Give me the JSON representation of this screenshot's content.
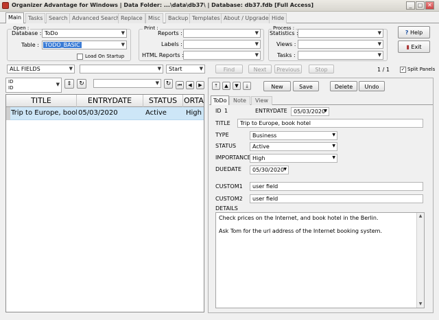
{
  "window": {
    "title": "Organizer Advantage for Windows | Data Folder: ...\\data\\db37\\ | Database: db37.fdb [Full Access]",
    "min": "_",
    "max": "□",
    "close": "✕"
  },
  "tabs": [
    "Main",
    "Tasks",
    "Search",
    "Advanced Search",
    "Replace",
    "Misc",
    "Backup",
    "Templates",
    "About / Upgrade",
    "Hide"
  ],
  "open_group": {
    "title": "Open :",
    "database_label": "Database :",
    "database_value": "ToDo",
    "table_label": "Table :",
    "table_value": "TODO_BASIC",
    "load_on_startup": "Load On Startup"
  },
  "print_group": {
    "title": "Print :",
    "reports": "Reports :",
    "labels": "Labels :",
    "html_reports": "HTML Reports :"
  },
  "process_group": {
    "title": "Process :",
    "statistics": "Statistics :",
    "views": "Views :",
    "tasks": "Tasks :"
  },
  "side_buttons": {
    "help": "Help",
    "exit": "Exit"
  },
  "search_bar": {
    "field": "ALL FIELDS",
    "start": "Start",
    "find": "Find",
    "next": "Next",
    "previous": "Previous",
    "stop": "Stop",
    "counter": "1 / 1",
    "split": "Split Panels"
  },
  "sort_bar": {
    "sort_field_top": "ID",
    "sort_field_bottom": "ID"
  },
  "grid": {
    "columns": [
      "TITLE",
      "ENTRYDATE",
      "STATUS",
      "ORTA"
    ],
    "rows": [
      [
        "Trip to Europe, book",
        "05/03/2020",
        "Active",
        "High"
      ]
    ]
  },
  "record_toolbar": {
    "new": "New",
    "save": "Save",
    "delete": "Delete",
    "undo": "Undo"
  },
  "record_tabs": [
    "ToDo",
    "Note",
    "View"
  ],
  "record": {
    "id_label": "ID",
    "id_value": "1",
    "entrydate_label": "ENTRYDATE",
    "entrydate": "05/03/2020",
    "title_label": "TITLE",
    "title": "Trip to Europe, book hotel",
    "type_label": "TYPE",
    "type": "Business",
    "status_label": "STATUS",
    "status": "Active",
    "importance_label": "IMPORTANCE",
    "importance": "High",
    "duedate_label": "DUEDATE",
    "duedate": "05/30/2020",
    "custom1_label": "CUSTOM1",
    "custom1": "user field",
    "custom2_label": "CUSTOM2",
    "custom2": "user field",
    "details_label": "DETAILS",
    "details_line1": "Check prices on the Internet, and book hotel in the Berlin.",
    "details_line2": "Ask Tom for the url address of the Internet booking system."
  },
  "colors": {
    "selection": "#cde6f7",
    "title_highlight": "#3a7bd5"
  }
}
